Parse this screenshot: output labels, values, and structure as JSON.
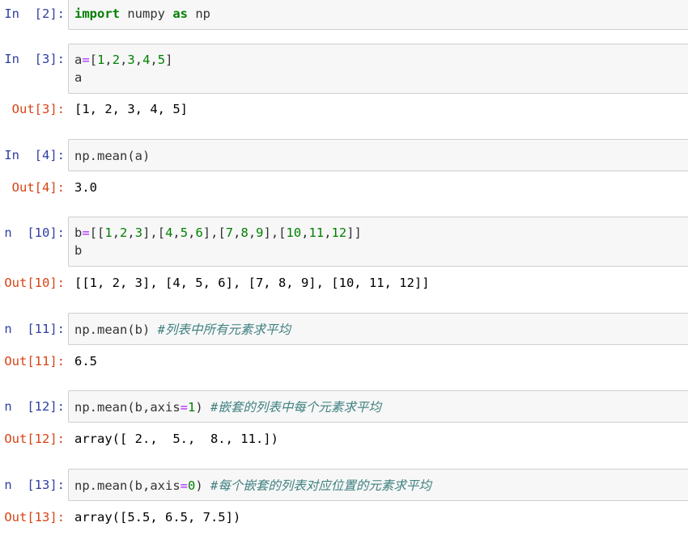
{
  "cells": [
    {
      "in_prompt": "In  [2]:",
      "code": [
        [
          {
            "t": "import",
            "c": "kw"
          },
          {
            "t": " numpy ",
            "c": ""
          },
          {
            "t": "as",
            "c": "kw"
          },
          {
            "t": " np",
            "c": ""
          }
        ]
      ]
    },
    {
      "in_prompt": "In  [3]:",
      "code": [
        [
          {
            "t": "a",
            "c": ""
          },
          {
            "t": "=",
            "c": "op"
          },
          {
            "t": "[",
            "c": ""
          },
          {
            "t": "1",
            "c": "num"
          },
          {
            "t": ",",
            "c": ""
          },
          {
            "t": "2",
            "c": "num"
          },
          {
            "t": ",",
            "c": ""
          },
          {
            "t": "3",
            "c": "num"
          },
          {
            "t": ",",
            "c": ""
          },
          {
            "t": "4",
            "c": "num"
          },
          {
            "t": ",",
            "c": ""
          },
          {
            "t": "5",
            "c": "num"
          },
          {
            "t": "]",
            "c": ""
          }
        ],
        [
          {
            "t": "a",
            "c": ""
          }
        ]
      ],
      "out_prompt": "Out[3]:",
      "output": "[1, 2, 3, 4, 5]"
    },
    {
      "in_prompt": "In  [4]:",
      "code": [
        [
          {
            "t": "np.mean(a)",
            "c": ""
          }
        ]
      ],
      "out_prompt": "Out[4]:",
      "output": "3.0"
    },
    {
      "in_prompt": "n  [10]:",
      "code": [
        [
          {
            "t": "b",
            "c": ""
          },
          {
            "t": "=",
            "c": "op"
          },
          {
            "t": "[[",
            "c": ""
          },
          {
            "t": "1",
            "c": "num"
          },
          {
            "t": ",",
            "c": ""
          },
          {
            "t": "2",
            "c": "num"
          },
          {
            "t": ",",
            "c": ""
          },
          {
            "t": "3",
            "c": "num"
          },
          {
            "t": "],[",
            "c": ""
          },
          {
            "t": "4",
            "c": "num"
          },
          {
            "t": ",",
            "c": ""
          },
          {
            "t": "5",
            "c": "num"
          },
          {
            "t": ",",
            "c": ""
          },
          {
            "t": "6",
            "c": "num"
          },
          {
            "t": "],[",
            "c": ""
          },
          {
            "t": "7",
            "c": "num"
          },
          {
            "t": ",",
            "c": ""
          },
          {
            "t": "8",
            "c": "num"
          },
          {
            "t": ",",
            "c": ""
          },
          {
            "t": "9",
            "c": "num"
          },
          {
            "t": "],[",
            "c": ""
          },
          {
            "t": "10",
            "c": "num"
          },
          {
            "t": ",",
            "c": ""
          },
          {
            "t": "11",
            "c": "num"
          },
          {
            "t": ",",
            "c": ""
          },
          {
            "t": "12",
            "c": "num"
          },
          {
            "t": "]]",
            "c": ""
          }
        ],
        [
          {
            "t": "b",
            "c": ""
          }
        ]
      ],
      "out_prompt": "Out[10]:",
      "output": "[[1, 2, 3], [4, 5, 6], [7, 8, 9], [10, 11, 12]]"
    },
    {
      "in_prompt": "n  [11]:",
      "code": [
        [
          {
            "t": "np.mean(b) ",
            "c": ""
          },
          {
            "t": "#列表中所有元素求平均",
            "c": "cm"
          }
        ]
      ],
      "out_prompt": "Out[11]:",
      "output": "6.5"
    },
    {
      "in_prompt": "n  [12]:",
      "code": [
        [
          {
            "t": "np.mean(b,axis",
            "c": ""
          },
          {
            "t": "=",
            "c": "op"
          },
          {
            "t": "1",
            "c": "num"
          },
          {
            "t": ") ",
            "c": ""
          },
          {
            "t": "#嵌套的列表中每个元素求平均",
            "c": "cm"
          }
        ]
      ],
      "out_prompt": "Out[12]:",
      "output": "array([ 2.,  5.,  8., 11.])"
    },
    {
      "in_prompt": "n  [13]:",
      "code": [
        [
          {
            "t": "np.mean(b,axis",
            "c": ""
          },
          {
            "t": "=",
            "c": "op"
          },
          {
            "t": "0",
            "c": "num"
          },
          {
            "t": ") ",
            "c": ""
          },
          {
            "t": "#每个嵌套的列表对应位置的元素求平均",
            "c": "cm"
          }
        ]
      ],
      "out_prompt": "Out[13]:",
      "output": "array([5.5, 6.5, 7.5])"
    }
  ],
  "colors": {
    "in_prompt": "#303f9f",
    "out_prompt": "#d84315",
    "keyword": "#008000",
    "number": "#008000",
    "operator": "#aa22ff",
    "comment": "#408080",
    "cell_bg": "#f7f7f7",
    "cell_border": "#cfcfcf"
  }
}
